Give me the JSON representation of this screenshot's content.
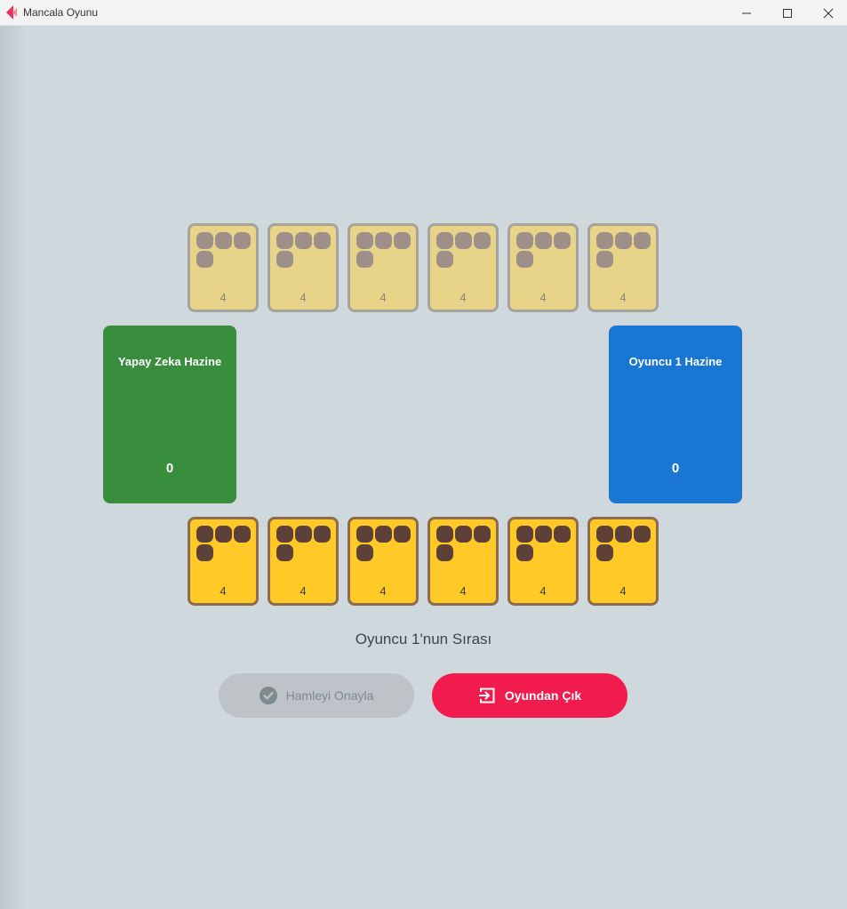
{
  "window": {
    "title": "Mancala Oyunu",
    "icons": {
      "app": "mancala-app-icon",
      "minimize": "minimize-icon",
      "maximize": "maximize-icon",
      "close": "close-icon"
    }
  },
  "board": {
    "ai_pits": [
      {
        "count": "4",
        "stones": 4
      },
      {
        "count": "4",
        "stones": 4
      },
      {
        "count": "4",
        "stones": 4
      },
      {
        "count": "4",
        "stones": 4
      },
      {
        "count": "4",
        "stones": 4
      },
      {
        "count": "4",
        "stones": 4
      }
    ],
    "player_pits": [
      {
        "count": "4",
        "stones": 4
      },
      {
        "count": "4",
        "stones": 4
      },
      {
        "count": "4",
        "stones": 4
      },
      {
        "count": "4",
        "stones": 4
      },
      {
        "count": "4",
        "stones": 4
      },
      {
        "count": "4",
        "stones": 4
      }
    ],
    "ai_store": {
      "title": "Yapay Zeka Hazine",
      "count": "0"
    },
    "player_store": {
      "title": "Oyuncu 1 Hazine",
      "count": "0"
    }
  },
  "status": {
    "turn_text": "Oyuncu 1'nun Sırası"
  },
  "actions": {
    "confirm": {
      "label": "Hamleyi Onayla",
      "icon": "check-circle-icon",
      "enabled": false
    },
    "quit": {
      "label": "Oyundan Çık",
      "icon": "exit-icon",
      "enabled": true
    }
  },
  "colors": {
    "background": "#cfd8dd",
    "ai_pit": "#e8d488",
    "player_pit": "#ffc928",
    "ai_store": "#388e3c",
    "player_store": "#1976d2",
    "quit_button": "#f21b4e",
    "confirm_button_disabled": "#bdc3c7"
  }
}
